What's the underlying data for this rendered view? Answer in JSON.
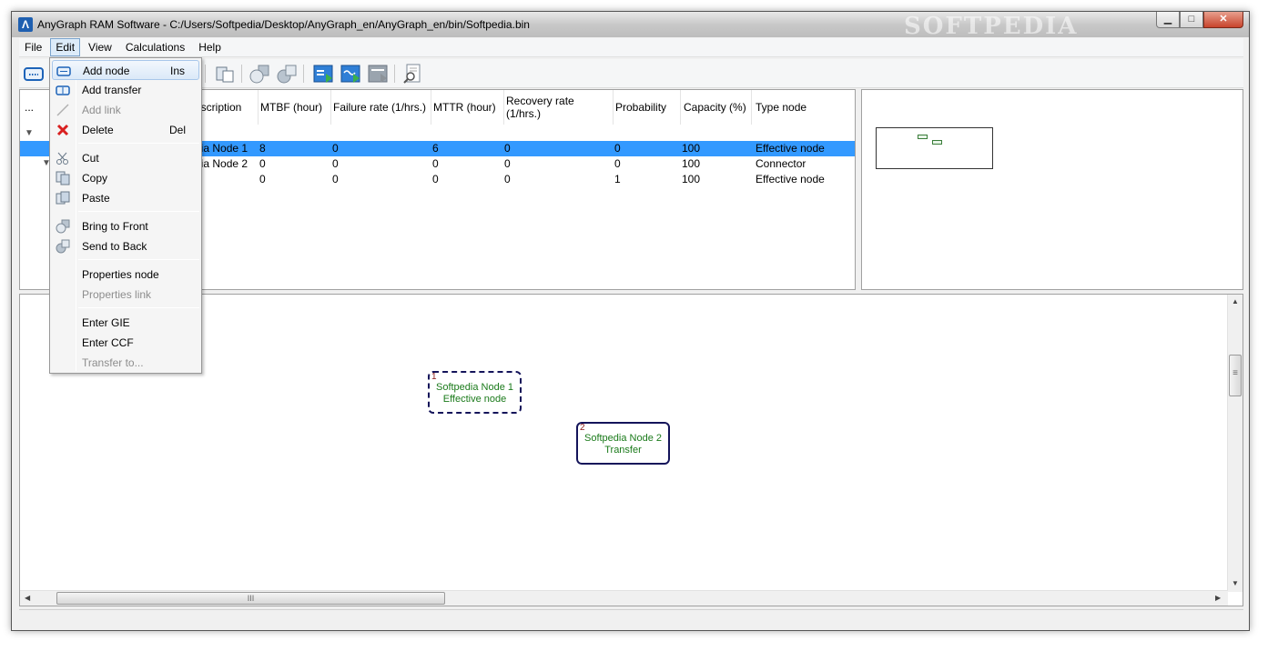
{
  "window": {
    "title": "AnyGraph RAM Software - C:/Users/Softpedia/Desktop/AnyGraph_en/AnyGraph_en/bin/Softpedia.bin",
    "watermark": "SOFTPEDIA",
    "app_icon": "anygraph-logo-icon",
    "minimize_icon": "minimize-icon",
    "maximize_icon": "maximize-icon",
    "close_icon": "close-icon"
  },
  "menubar": {
    "items": [
      "File",
      "Edit",
      "View",
      "Calculations",
      "Help"
    ],
    "active": "Edit"
  },
  "toolbar": {
    "buttons": [
      "add-node-icon",
      "paste-icon",
      "bring-to-front-icon",
      "send-to-back-icon",
      "properties-node-icon",
      "chart-run-icon",
      "report-run-icon",
      "search-document-icon"
    ]
  },
  "table": {
    "first_header": "...",
    "headers": [
      "escription",
      "MTBF (hour)",
      "Failure rate (1/hrs.)",
      "MTTR (hour)",
      "Recovery rate (1/hrs.)",
      "Probability",
      "Capacity (%)",
      "Type node"
    ],
    "rows": [
      {
        "description": "dia Node 1",
        "mtbf": "8",
        "failure_rate": "0",
        "mttr": "6",
        "recovery_rate": "0",
        "probability": "0",
        "capacity": "100",
        "type": "Effective node",
        "selected": true
      },
      {
        "description": "dia Node 2",
        "mtbf": "0",
        "failure_rate": "0",
        "mttr": "0",
        "recovery_rate": "0",
        "probability": "0",
        "capacity": "100",
        "type": "Connector",
        "selected": false
      },
      {
        "description": "",
        "mtbf": "0",
        "failure_rate": "0",
        "mttr": "0",
        "recovery_rate": "0",
        "probability": "1",
        "capacity": "100",
        "type": "Effective node",
        "selected": false
      }
    ]
  },
  "canvas": {
    "nodes": [
      {
        "number": "1",
        "name": "Softpedia Node 1",
        "kind": "Effective node",
        "style": "dashed"
      },
      {
        "number": "2",
        "name": "Softpedia Node 2",
        "kind": "Transfer",
        "style": "solid"
      }
    ],
    "hscroll_grip": "III",
    "vscroll_grip": "≡"
  },
  "edit_menu": {
    "items": [
      {
        "label": "Add node",
        "shortcut": "Ins",
        "icon": "add-node-icon",
        "enabled": true,
        "hover": true
      },
      {
        "label": "Add transfer",
        "shortcut": "",
        "icon": "add-transfer-icon",
        "enabled": true
      },
      {
        "label": "Add link",
        "shortcut": "",
        "icon": "add-link-icon",
        "enabled": false
      },
      {
        "label": "Delete",
        "shortcut": "Del",
        "icon": "delete-icon",
        "enabled": true
      },
      {
        "label": "Cut",
        "shortcut": "",
        "icon": "cut-icon",
        "enabled": true
      },
      {
        "label": "Copy",
        "shortcut": "",
        "icon": "copy-icon",
        "enabled": true
      },
      {
        "label": "Paste",
        "shortcut": "",
        "icon": "paste-icon",
        "enabled": true
      },
      {
        "label": "Bring to Front",
        "shortcut": "",
        "icon": "bring-to-front-icon",
        "enabled": true
      },
      {
        "label": "Send to Back",
        "shortcut": "",
        "icon": "send-to-back-icon",
        "enabled": true
      },
      {
        "label": "Properties node",
        "shortcut": "",
        "icon": "",
        "enabled": true
      },
      {
        "label": "Properties link",
        "shortcut": "",
        "icon": "",
        "enabled": false
      },
      {
        "label": "Enter GIE",
        "shortcut": "",
        "icon": "",
        "enabled": true
      },
      {
        "label": "Enter CCF",
        "shortcut": "",
        "icon": "",
        "enabled": true
      },
      {
        "label": "Transfer to...",
        "shortcut": "",
        "icon": "",
        "enabled": false
      }
    ]
  },
  "colors": {
    "selection": "#3399ff",
    "node_border": "#14145a",
    "node_text": "#1a7a1a",
    "delete_red": "#d92020"
  }
}
